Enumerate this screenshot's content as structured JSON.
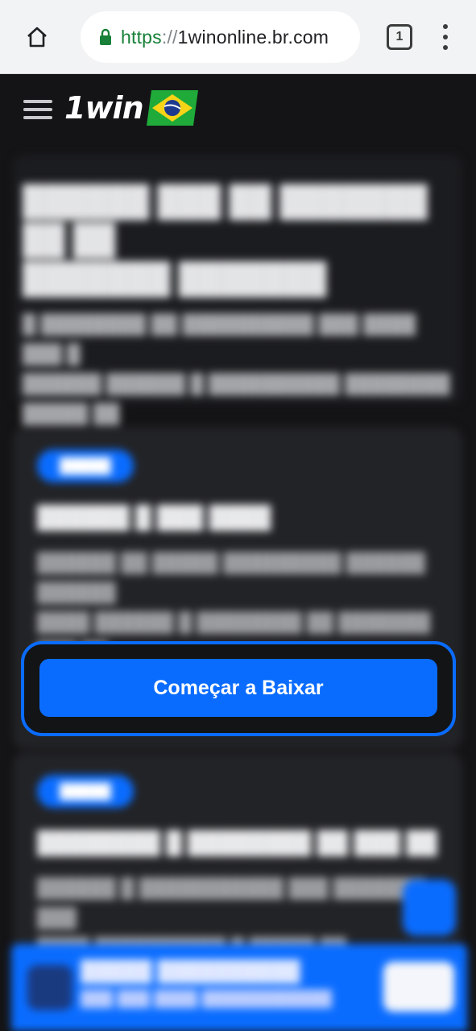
{
  "browser": {
    "url_scheme": "https",
    "url_separator": "://",
    "url_host": "1winonline.br.com",
    "tab_count": "1"
  },
  "header": {
    "logo_text": "1win"
  },
  "cta": {
    "label": "Começar a Baixar"
  },
  "colors": {
    "accent": "#0a6cff",
    "background": "#141416",
    "card": "#222326"
  },
  "icons": [
    "home-icon",
    "lock-icon",
    "tabs-icon",
    "overflow-menu-icon",
    "hamburger-icon",
    "brazil-flag-icon"
  ]
}
